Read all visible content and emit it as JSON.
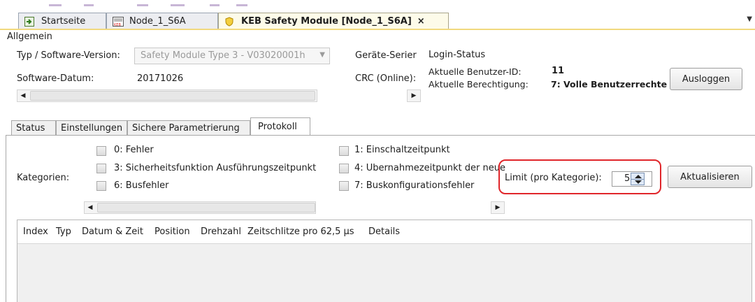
{
  "doc_tabs": [
    {
      "label": "Startseite",
      "icon": "home-page-icon",
      "active": false
    },
    {
      "label": "Node_1_S6A",
      "icon": "keb-device-icon",
      "active": false
    },
    {
      "label": "KEB Safety Module [Node_1_S6A]",
      "icon": "shield-icon",
      "active": true,
      "close": "×"
    }
  ],
  "allgemein": {
    "title": "Allgemein",
    "type_label": "Typ / Software-Version:",
    "type_value": "Safety Module Type 3 - V03020001h",
    "date_label": "Software-Datum:",
    "date_value": "20171026",
    "serial_label": "Geräte-Serier",
    "crc_label": "CRC (Online):"
  },
  "login": {
    "title": "Login-Status",
    "user_label": "Aktuelle Benutzer-ID:",
    "user_value": "11",
    "perm_label": "Aktuelle Berechtigung:",
    "perm_value": "7: Volle Benutzerrechte",
    "logout_button": "Ausloggen"
  },
  "section_tabs": [
    "Status",
    "Einstellungen",
    "Sichere Parametrierung",
    "Protokoll"
  ],
  "active_section_tab": "Protokoll",
  "protokoll": {
    "categories_label": "Kategorien:",
    "categories": [
      {
        "label": "0: Fehler",
        "checked": false
      },
      {
        "label": "3: Sicherheitsfunktion Ausführungszeitpunkt",
        "checked": false
      },
      {
        "label": "6: Busfehler",
        "checked": false
      },
      {
        "label": "1: Einschaltzeitpunkt",
        "checked": false
      },
      {
        "label": "4: Übernahmezeitpunkt der neue",
        "checked": false
      },
      {
        "label": "7: Buskonfigurationsfehler",
        "checked": false
      }
    ],
    "limit_label": "Limit (pro Kategorie):",
    "limit_value": "5",
    "refresh_button": "Aktualisieren",
    "columns": [
      "Index",
      "Typ",
      "Datum & Zeit",
      "Position",
      "Drehzahl",
      "Zeitschlitze pro 62,5 µs",
      "Details"
    ],
    "rows": []
  },
  "colors": {
    "highlight_border": "#e0262b",
    "active_tab_bg": "#fdfbe9",
    "tab_strip_accent": "#f1d97e"
  }
}
